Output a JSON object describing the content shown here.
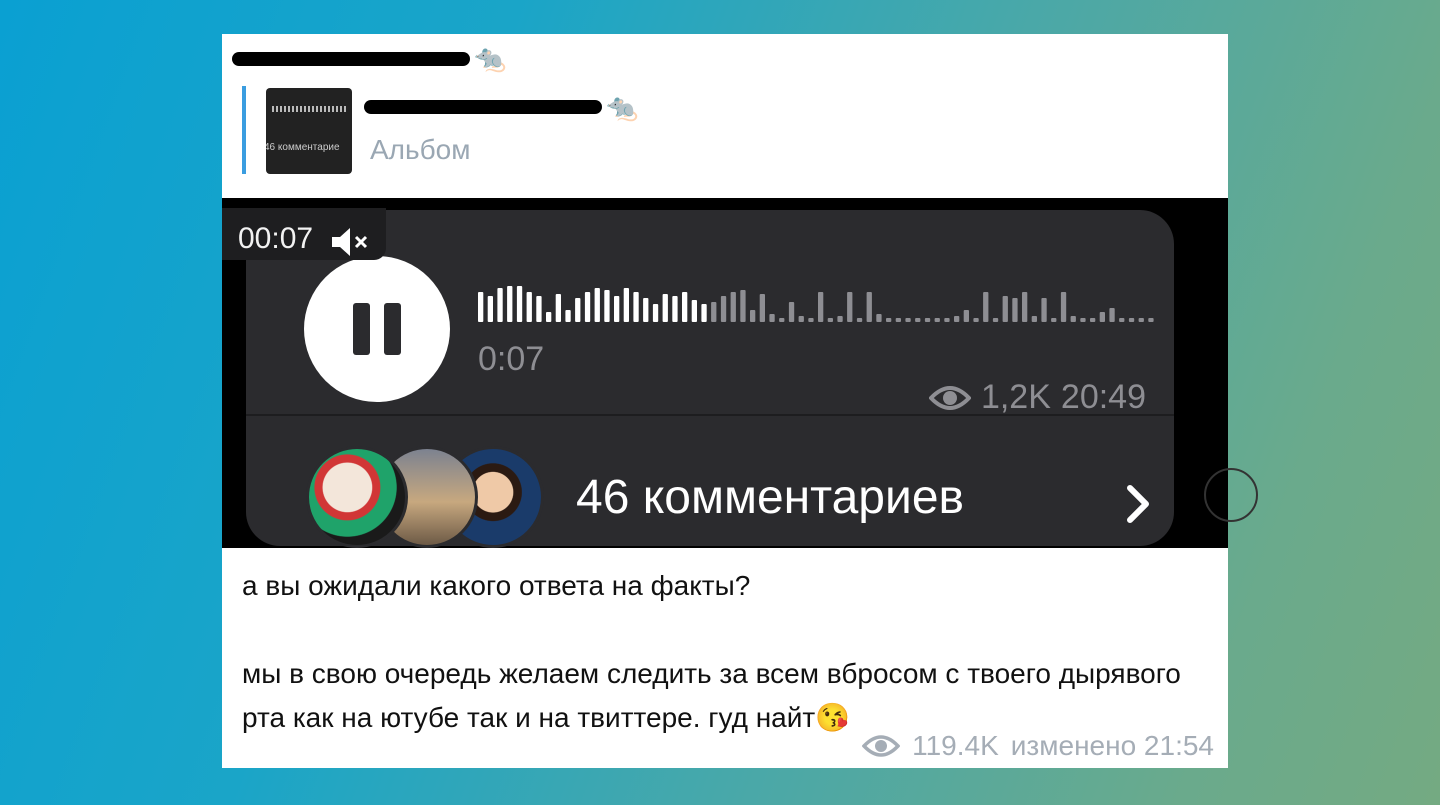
{
  "post": {
    "sender_emoji": "🐀",
    "reply": {
      "title_emoji": "🐀",
      "subtitle": "Альбом",
      "thumb_text": "46 комментарие"
    },
    "voice": {
      "timer": "00:07",
      "duration": "0:07",
      "views": "1,2K",
      "time": "20:49",
      "progress": 0.34,
      "comments_label": "46 комментариев"
    },
    "caption": {
      "line1": "а вы ожидали какого ответа на факты?",
      "line2": "мы в свою очередь желаем следить за всем вбросом с твоего дырявого рта как на ютубе так и на твиттере. гуд найт",
      "line2_emoji": "😘"
    },
    "footer": {
      "views": "119.4K",
      "edited": "изменено 21:54"
    }
  },
  "icons": {
    "mute": "speaker-muted-icon",
    "pause": "pause-icon",
    "eye": "eye-icon",
    "chevron": "chevron-right-icon"
  },
  "colors": {
    "reply_accent": "#3a9de0",
    "bubble": "#2b2b2e",
    "muted_text": "#8e8e93",
    "footer_text": "#a5adb6"
  }
}
